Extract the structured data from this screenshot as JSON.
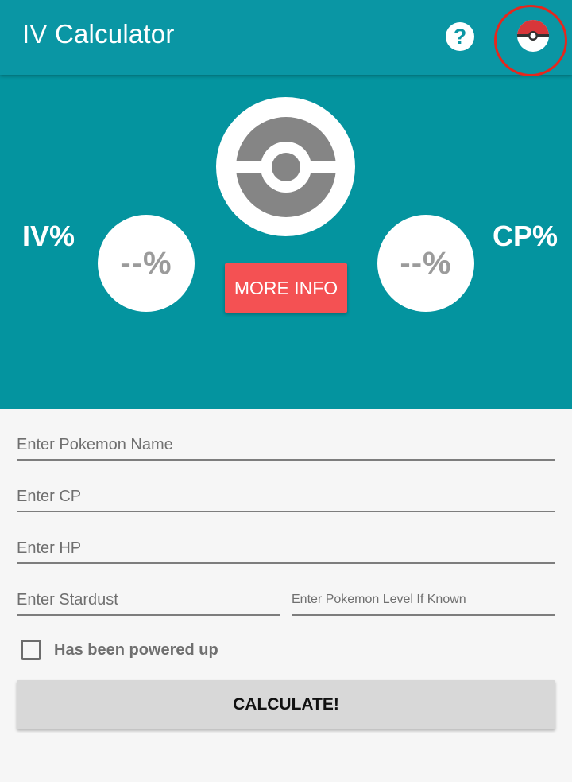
{
  "app_bar": {
    "title": "IV Calculator",
    "help_icon": "question-circle-icon",
    "help_glyph": "?",
    "pokeball_icon": "pokeball-icon",
    "highlight_color": "#e5271d"
  },
  "hero": {
    "iv_label": "IV%",
    "cp_label": "CP%",
    "iv_value": "--%",
    "cp_value": "--%",
    "pokeball_icon": "pokeball-placeholder-icon",
    "more_info_label": "MORE INFO"
  },
  "form": {
    "pokemon_name_placeholder": "Enter Pokemon Name",
    "cp_placeholder": "Enter CP",
    "hp_placeholder": "Enter HP",
    "stardust_placeholder": "Enter Stardust",
    "level_placeholder": "Enter Pokemon Level If Known",
    "powered_up_label": "Has been powered up",
    "powered_up_checked": false,
    "calculate_label": "CALCULATE!"
  },
  "colors": {
    "appbar": "#0a96a4",
    "hero": "#04949f",
    "more_info": "#f45153",
    "calculate_button": "#d8d8d8",
    "background": "#f6f6f6"
  }
}
